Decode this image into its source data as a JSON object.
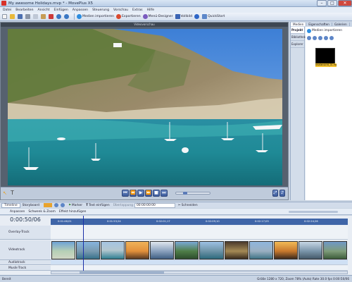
{
  "window": {
    "title": "My awesome Holidays.mvp * - MovePlus X5"
  },
  "menu": [
    "Datei",
    "Bearbeiten",
    "Ansicht",
    "Einfügen",
    "Anpassen",
    "Steuerung",
    "Vorschau",
    "Extras",
    "Hilfe"
  ],
  "toolbar": {
    "import_label": "Medien importieren",
    "export_label": "Exportieren",
    "designer_label": "Menü-Designer",
    "fullscreen_label": "Vollbild",
    "quickstart_label": "QuickStart"
  },
  "preview": {
    "header": "Videovorschau"
  },
  "right_panel": {
    "tabs": [
      "Medien",
      "Eigenschaften",
      "Galerien"
    ],
    "side_items": [
      "Projekt",
      "Bibliothek",
      "Explorer"
    ],
    "import_label": "Medien importieren",
    "clip_label": "Inselansicht_01.mp4"
  },
  "timeline": {
    "tabs": [
      "Timeline",
      "Storyboard"
    ],
    "marker_label": "Marker",
    "text_label": "Text einfügen",
    "overlap_label": "Überlappung",
    "overlap_value": "00:00:00:00",
    "cut_label": "Schneiden",
    "adjust_label": "Anpassen",
    "pan_zoom_label": "Schwenk & Zoom",
    "effect_label": "Effekt hinzufügen",
    "timecode": "0:00:50/06",
    "ruler_ticks": [
      "0:01:46;01",
      "0:01:53;24",
      "0:02:01;17",
      "0:02:09;10",
      "0:02:17;03",
      "0:02:24;26"
    ],
    "tracks": [
      "Overlay-Track",
      "Videotrack",
      "Audiotrack",
      "Musik-Track"
    ]
  },
  "status": {
    "left": "Bereit",
    "right": "Größe 1280 x 720, Zoom 78% (Auto) Rate 30.0 fps  0:00:50/06"
  },
  "colors": {
    "timeline_ruler": "#3f65a8",
    "clip_label": "#f2c12e",
    "playhead": "#1a2fa8"
  }
}
